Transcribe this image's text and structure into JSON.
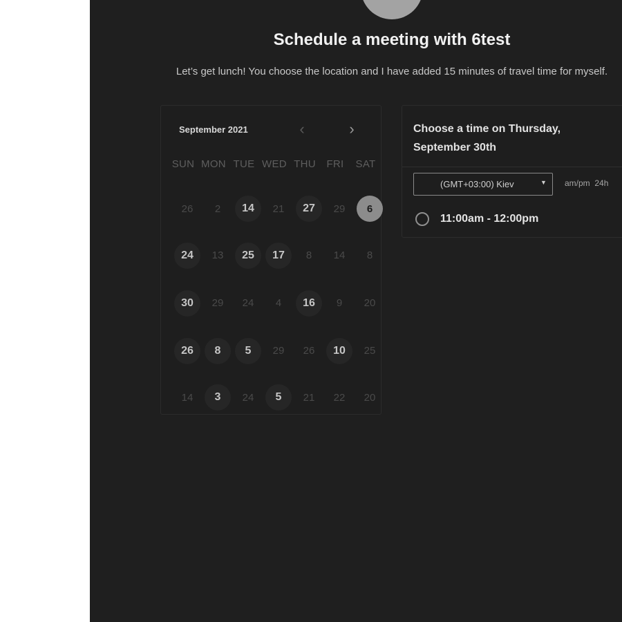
{
  "header": {
    "title": "Schedule a meeting with 6test",
    "description": "Let’s get lunch! You choose the location and I have added 15 minutes of travel time for myself."
  },
  "calendar": {
    "month_label": "September 2021",
    "prev_icon": "chevron-left-icon",
    "next_icon": "chevron-right-icon",
    "weekdays": [
      "SUN",
      "MON",
      "TUE",
      "WED",
      "THU",
      "FRI",
      "SAT"
    ],
    "weeks": [
      [
        "26",
        "2",
        "14",
        "21",
        "27",
        "29",
        "6"
      ],
      [
        "24",
        "13",
        "25",
        "17",
        "8",
        "14",
        "8"
      ],
      [
        "30",
        "29",
        "24",
        "4",
        "16",
        "9",
        "20"
      ],
      [
        "26",
        "8",
        "5",
        "29",
        "26",
        "10",
        "25"
      ],
      [
        "14",
        "3",
        "24",
        "5",
        "21",
        "22",
        "20"
      ]
    ],
    "available": [
      [
        false,
        false,
        true,
        false,
        true,
        false,
        true
      ],
      [
        true,
        false,
        true,
        true,
        false,
        false,
        false
      ],
      [
        true,
        false,
        false,
        false,
        true,
        false,
        false
      ],
      [
        true,
        true,
        true,
        false,
        false,
        true,
        false
      ],
      [
        false,
        true,
        false,
        true,
        false,
        false,
        false
      ]
    ],
    "selected_day": "6"
  },
  "time_panel": {
    "heading": "Choose a time on Thursday, September 30th",
    "timezone": "(GMT+03:00) Kiev",
    "format_ampm": "am/pm",
    "format_24h": "24h",
    "slots": [
      "11:00am - 12:00pm"
    ]
  },
  "colors": {
    "background": "#1f1f1f",
    "selected_day": "#8c8c8c",
    "available_day": "#262626"
  }
}
